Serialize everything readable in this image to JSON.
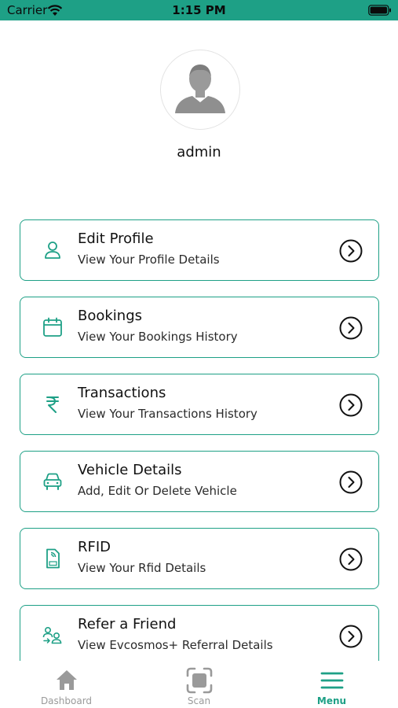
{
  "status_bar": {
    "carrier": "Carrier",
    "time": "1:15 PM"
  },
  "profile": {
    "username": "admin"
  },
  "menu": {
    "items": [
      {
        "title": "Edit Profile",
        "subtitle": "View Your Profile Details",
        "icon": "person-icon"
      },
      {
        "title": "Bookings",
        "subtitle": "View Your Bookings History",
        "icon": "calendar-icon"
      },
      {
        "title": "Transactions",
        "subtitle": "View Your Transactions History",
        "icon": "rupee-icon"
      },
      {
        "title": "Vehicle Details",
        "subtitle": "Add, Edit Or Delete Vehicle",
        "icon": "car-icon"
      },
      {
        "title": "RFID",
        "subtitle": "View Your Rfid Details",
        "icon": "rfid-card-icon"
      },
      {
        "title": "Refer a Friend",
        "subtitle": "View Evcosmos+ Referral Details",
        "icon": "refer-friends-icon"
      }
    ]
  },
  "tab_bar": {
    "tabs": [
      {
        "label": "Dashboard",
        "icon": "home-icon"
      },
      {
        "label": "Scan",
        "icon": "scan-icon"
      },
      {
        "label": "Menu",
        "icon": "hamburger-menu-icon"
      }
    ],
    "active": "Menu"
  },
  "colors": {
    "accent": "#1ea086",
    "inactive": "#9a9a9a",
    "text": "#111111"
  }
}
